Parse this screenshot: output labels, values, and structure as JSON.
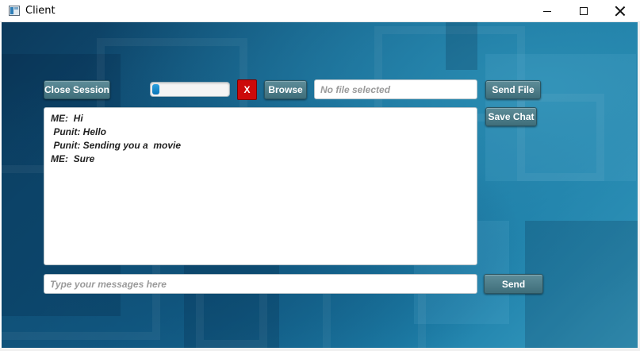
{
  "window": {
    "title": "Client"
  },
  "toolbar": {
    "close_session_label": "Close Session",
    "cancel_label": "X",
    "browse_label": "Browse",
    "file_placeholder": "No file selected",
    "send_file_label": "Send File",
    "save_chat_label": "Save Chat",
    "transfer_progress": 0.09
  },
  "chat": {
    "messages": [
      {
        "text": "ME:  Hi"
      },
      {
        "text": " Punit: Hello"
      },
      {
        "text": " Punit: Sending you a  movie"
      },
      {
        "text": "ME:  Sure"
      }
    ]
  },
  "composer": {
    "placeholder": "Type your messages here",
    "send_label": "Send"
  },
  "colors": {
    "button": "#4a7a86",
    "cancel_button": "#cc0a0a",
    "progress_fill": "#1a8ccc",
    "background": "#125e89"
  }
}
